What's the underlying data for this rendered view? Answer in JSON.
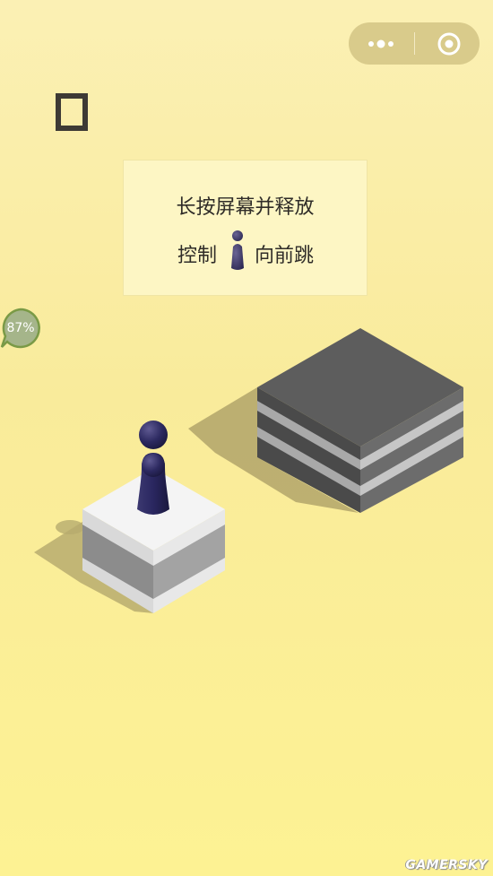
{
  "menu_capsule": {
    "more_icon": "more-dots-icon",
    "close_icon": "target-circle-icon"
  },
  "score": {
    "value": "0"
  },
  "tip": {
    "line1": "长按屏幕并释放",
    "line2_prefix": "控制",
    "line2_suffix": "向前跳"
  },
  "progress_badge": {
    "value": "87%"
  },
  "watermark": "GAMERSKY",
  "colors": {
    "background_top": "#fbf0b4",
    "background_bottom": "#fdf293",
    "player": "#2e2b5a",
    "target_block": "#5a5a5a",
    "current_block": "#f3f3f3"
  }
}
